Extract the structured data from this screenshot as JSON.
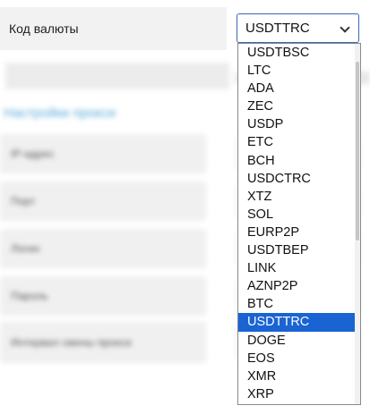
{
  "field": {
    "label": "Код валюты",
    "selected_value": "USDTTRC"
  },
  "background": {
    "section_title": "Настройки прокси",
    "rows": [
      "IP-адрес",
      "Порт",
      "Логин",
      "Пароль",
      "Интервал смены прокси"
    ]
  },
  "dropdown": {
    "options": [
      "USDTBSC",
      "LTC",
      "ADA",
      "ZEC",
      "USDP",
      "ETC",
      "BCH",
      "USDCTRC",
      "XTZ",
      "SOL",
      "EURP2P",
      "USDTBEP",
      "LINK",
      "AZNP2P",
      "BTC",
      "USDTTRC",
      "DOGE",
      "EOS",
      "XMR",
      "XRP"
    ],
    "selected_index": 15
  },
  "colors": {
    "accent": "#1a63d2",
    "select_border": "#3a66b5"
  }
}
